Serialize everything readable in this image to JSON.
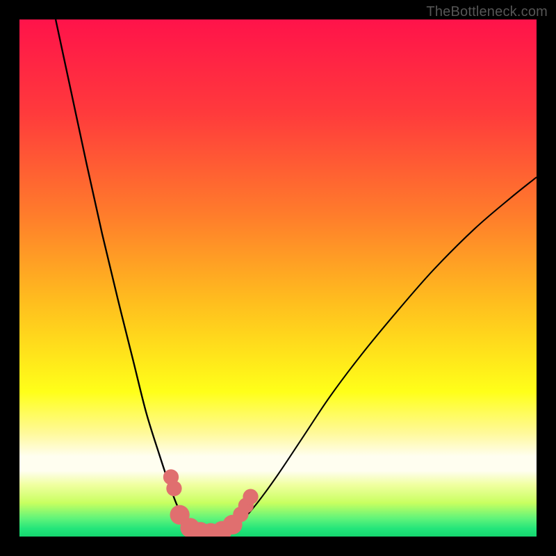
{
  "watermark": "TheBottleneck.com",
  "chart_data": {
    "type": "line",
    "title": "",
    "xlabel": "",
    "ylabel": "",
    "xlim": [
      0,
      100
    ],
    "ylim": [
      0,
      100
    ],
    "gradient_stops": [
      {
        "offset": 0.0,
        "color": "#ff134a"
      },
      {
        "offset": 0.18,
        "color": "#ff3a3c"
      },
      {
        "offset": 0.38,
        "color": "#ff7d2b"
      },
      {
        "offset": 0.55,
        "color": "#ffbf1e"
      },
      {
        "offset": 0.72,
        "color": "#ffff19"
      },
      {
        "offset": 0.8,
        "color": "#fff99a"
      },
      {
        "offset": 0.845,
        "color": "#fffef0"
      },
      {
        "offset": 0.873,
        "color": "#fffef0"
      },
      {
        "offset": 0.9,
        "color": "#f0ffa0"
      },
      {
        "offset": 0.935,
        "color": "#c8ff60"
      },
      {
        "offset": 0.965,
        "color": "#60f47a"
      },
      {
        "offset": 0.985,
        "color": "#23e57a"
      },
      {
        "offset": 1.0,
        "color": "#15d66f"
      }
    ],
    "series": [
      {
        "name": "left-curve",
        "color": "#000000",
        "points": [
          {
            "x": 7.0,
            "y": 100.0
          },
          {
            "x": 10.0,
            "y": 86.0
          },
          {
            "x": 13.0,
            "y": 72.0
          },
          {
            "x": 16.0,
            "y": 58.5
          },
          {
            "x": 19.0,
            "y": 46.0
          },
          {
            "x": 22.0,
            "y": 34.0
          },
          {
            "x": 24.5,
            "y": 24.0
          },
          {
            "x": 27.0,
            "y": 16.0
          },
          {
            "x": 29.0,
            "y": 10.0
          },
          {
            "x": 30.5,
            "y": 6.0
          },
          {
            "x": 32.0,
            "y": 3.2
          },
          {
            "x": 33.5,
            "y": 1.5
          },
          {
            "x": 35.0,
            "y": 0.6
          },
          {
            "x": 37.0,
            "y": 0.2
          }
        ]
      },
      {
        "name": "right-curve",
        "color": "#000000",
        "points": [
          {
            "x": 37.0,
            "y": 0.2
          },
          {
            "x": 39.0,
            "y": 0.4
          },
          {
            "x": 41.0,
            "y": 1.2
          },
          {
            "x": 43.0,
            "y": 3.0
          },
          {
            "x": 46.0,
            "y": 6.5
          },
          {
            "x": 50.0,
            "y": 12.0
          },
          {
            "x": 55.0,
            "y": 19.5
          },
          {
            "x": 60.0,
            "y": 27.0
          },
          {
            "x": 66.0,
            "y": 35.0
          },
          {
            "x": 73.0,
            "y": 43.5
          },
          {
            "x": 80.0,
            "y": 51.5
          },
          {
            "x": 88.0,
            "y": 59.5
          },
          {
            "x": 95.0,
            "y": 65.5
          },
          {
            "x": 100.0,
            "y": 69.5
          }
        ]
      }
    ],
    "markers": {
      "color": "#e06f6f",
      "radius_small": 1.5,
      "radius_large": 1.9,
      "points": [
        {
          "x": 29.3,
          "y": 11.5,
          "r": 1.5
        },
        {
          "x": 29.9,
          "y": 9.3,
          "r": 1.5
        },
        {
          "x": 31.0,
          "y": 4.2,
          "r": 1.9
        },
        {
          "x": 33.0,
          "y": 1.7,
          "r": 1.9
        },
        {
          "x": 35.0,
          "y": 0.9,
          "r": 1.9
        },
        {
          "x": 37.0,
          "y": 0.7,
          "r": 1.9
        },
        {
          "x": 39.2,
          "y": 1.1,
          "r": 1.9
        },
        {
          "x": 41.2,
          "y": 2.3,
          "r": 1.9
        },
        {
          "x": 42.8,
          "y": 4.3,
          "r": 1.5
        },
        {
          "x": 43.8,
          "y": 6.0,
          "r": 1.5
        },
        {
          "x": 44.7,
          "y": 7.7,
          "r": 1.5
        }
      ]
    }
  }
}
